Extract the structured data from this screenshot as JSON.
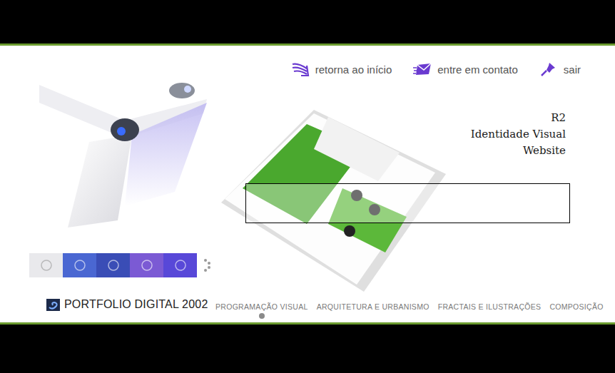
{
  "nav": [
    {
      "label": "retorna ao início",
      "icon": "waves"
    },
    {
      "label": "entre em contato",
      "icon": "mail"
    },
    {
      "label": "sair",
      "icon": "pin"
    }
  ],
  "project": {
    "lines": [
      "R2",
      "Identidade Visual",
      "Website"
    ]
  },
  "thumbnails": [
    {
      "color": "#e9e9ec"
    },
    {
      "color": "#4a67d2"
    },
    {
      "color": "#3a4db6"
    },
    {
      "color": "#7b5ad4"
    },
    {
      "color": "#5848d8"
    }
  ],
  "brand": {
    "title": "PORTFOLIO DIGITAL 2002"
  },
  "categories": [
    {
      "label": "PROGRAMAÇÃO VISUAL",
      "selected": true
    },
    {
      "label": "ARQUITETURA E URBANISMO",
      "selected": false
    },
    {
      "label": "FRACTAIS E ILUSTRAÇÕES",
      "selected": false
    },
    {
      "label": "COMPOSIÇÃO",
      "selected": false
    }
  ]
}
